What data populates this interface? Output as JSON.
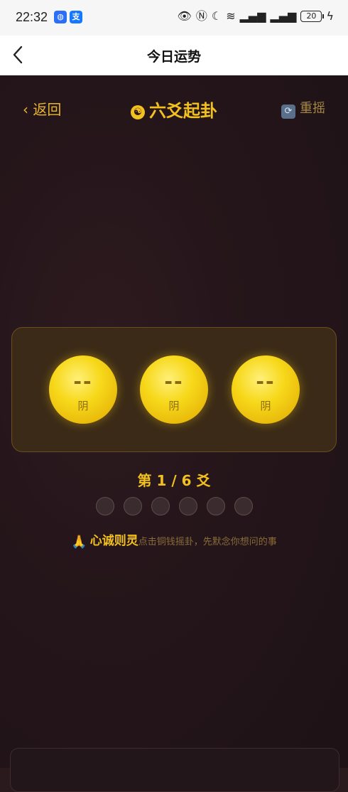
{
  "status": {
    "time": "22:32",
    "battery": "20"
  },
  "nav": {
    "title": "今日运势"
  },
  "header": {
    "back_label": "返回",
    "title": "六爻起卦",
    "reshake_label": "重摇"
  },
  "coins": [
    {
      "mark": "--",
      "label": "阴"
    },
    {
      "mark": "--",
      "label": "阴"
    },
    {
      "mark": "--",
      "label": "阴"
    }
  ],
  "progress": {
    "text": "第 1 / 6 爻",
    "current": 1,
    "total": 6
  },
  "hint": {
    "emphasis": "心诚则灵",
    "text": "点击铜钱摇卦，先默念你想问的事"
  },
  "colors": {
    "accent": "#f2c01f",
    "background": "#24151a"
  }
}
